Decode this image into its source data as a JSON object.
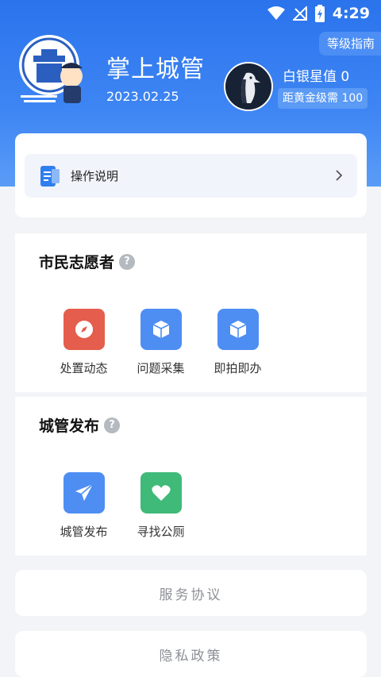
{
  "status_bar": {
    "time": "4:29"
  },
  "header": {
    "level_guide": "等级指南",
    "app_title": "掌上城管",
    "date": "2023.02.25",
    "rank_title": "白银星值 0",
    "rank_next": "距黄金级需 100"
  },
  "guide": {
    "label": "操作说明"
  },
  "volunteer": {
    "title": "市民志愿者",
    "tiles": [
      {
        "label": "处置动态",
        "color": "#e55d4c",
        "icon": "compass-icon"
      },
      {
        "label": "问题采集",
        "color": "#4e8ef3",
        "icon": "box-icon"
      },
      {
        "label": "即拍即办",
        "color": "#4e8ef3",
        "icon": "box-icon"
      }
    ]
  },
  "publish": {
    "title": "城管发布",
    "tiles": [
      {
        "label": "城管发布",
        "color": "#4e8ef3",
        "icon": "send-icon"
      },
      {
        "label": "寻找公厕",
        "color": "#3fba79",
        "icon": "heart-icon"
      }
    ]
  },
  "links": {
    "agreement": "服务协议",
    "privacy": "隐私政策"
  }
}
